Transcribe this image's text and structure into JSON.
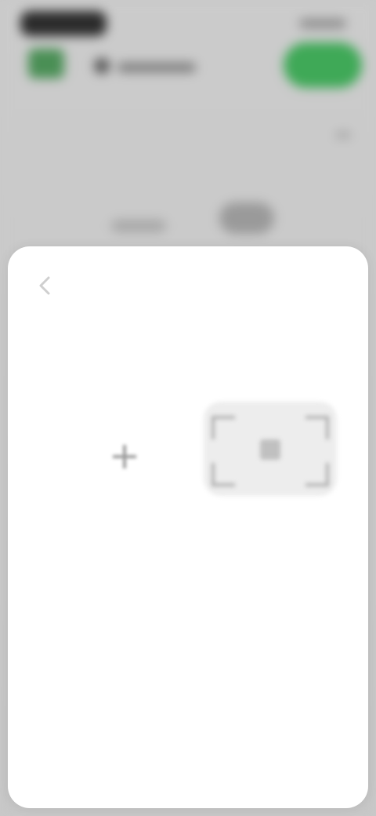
{
  "background": {
    "accent_color": "#3fa957",
    "icons": [
      "app-logo-icon",
      "avatar-icon"
    ]
  },
  "sheet": {
    "title": "",
    "description": "",
    "back_icon": "chevron-left-icon",
    "options": [
      {
        "id": "add",
        "icon": "plus-icon",
        "label": ""
      },
      {
        "id": "scan",
        "icon": "qr-scan-icon",
        "label": ""
      }
    ]
  }
}
